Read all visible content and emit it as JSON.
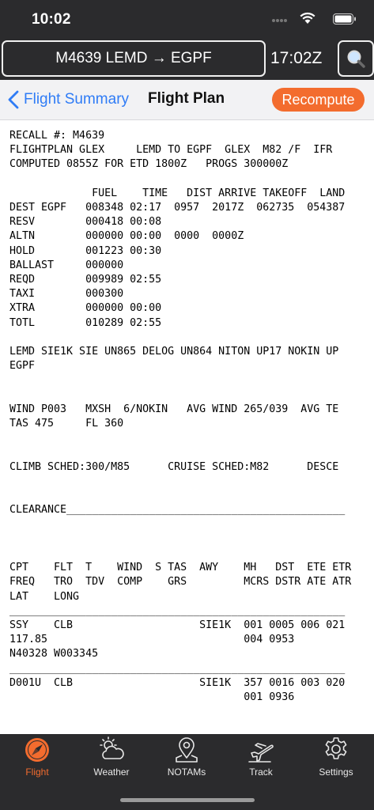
{
  "status_bar": {
    "time": "10:02"
  },
  "header": {
    "flight_route": "M4639 LEMD → EGPF",
    "zulu_time": "17:02Z"
  },
  "nav": {
    "back_label": "Flight Summary",
    "title": "Flight Plan",
    "recompute_label": "Recompute"
  },
  "flight_plan": {
    "lines": [
      "RECALL #: M4639",
      "FLIGHTPLAN GLEX     LEMD TO EGPF  GLEX  M82 /F  IFR",
      "COMPUTED 0855Z FOR ETD 1800Z   PROGS 300000Z",
      "",
      "             FUEL    TIME   DIST ARRIVE TAKEOFF  LAND",
      "DEST EGPF   008348 02:17  0957  2017Z  062735  054387",
      "RESV        000418 00:08",
      "ALTN        000000 00:00  0000  0000Z",
      "HOLD        001223 00:30",
      "BALLAST     000000",
      "REQD        009989 02:55",
      "TAXI        000300",
      "XTRA        000000 00:00",
      "TOTL        010289 02:55",
      "",
      "LEMD SIE1K SIE UN865 DELOG UN864 NITON UP17 NOKIN UP",
      "EGPF",
      "",
      "",
      "WIND P003   MXSH  6/NOKIN   AVG WIND 265/039  AVG TE",
      "TAS 475     FL 360",
      "",
      "",
      "CLIMB SCHED:300/M85      CRUISE SCHED:M82      DESCE",
      "",
      "",
      "CLEARANCE____________________________________________",
      "",
      "",
      "",
      "CPT    FLT  T    WIND  S TAS  AWY    MH   DST  ETE ETR",
      "FREQ   TRO  TDV  COMP    GRS         MCRS DSTR ATE ATR",
      "LAT    LONG",
      "_____________________________________________________",
      "SSY    CLB                    SIE1K  001 0005 006 021",
      "117.85                               004 0953",
      "N40328 W003345",
      "_____________________________________________________",
      "D001U  CLB                    SIE1K  357 0016 003 020",
      "                                     001 0936"
    ]
  },
  "tabs": [
    {
      "label": "Flight",
      "icon": "compass-icon",
      "active": true
    },
    {
      "label": "Weather",
      "icon": "weather-icon",
      "active": false
    },
    {
      "label": "NOTAMs",
      "icon": "map-pin-icon",
      "active": false
    },
    {
      "label": "Track",
      "icon": "airplane-icon",
      "active": false
    },
    {
      "label": "Settings",
      "icon": "gear-icon",
      "active": false
    }
  ],
  "colors": {
    "accent": "#f36c2e",
    "link": "#2f7cf6",
    "dark_bar": "#2b2b2d"
  }
}
